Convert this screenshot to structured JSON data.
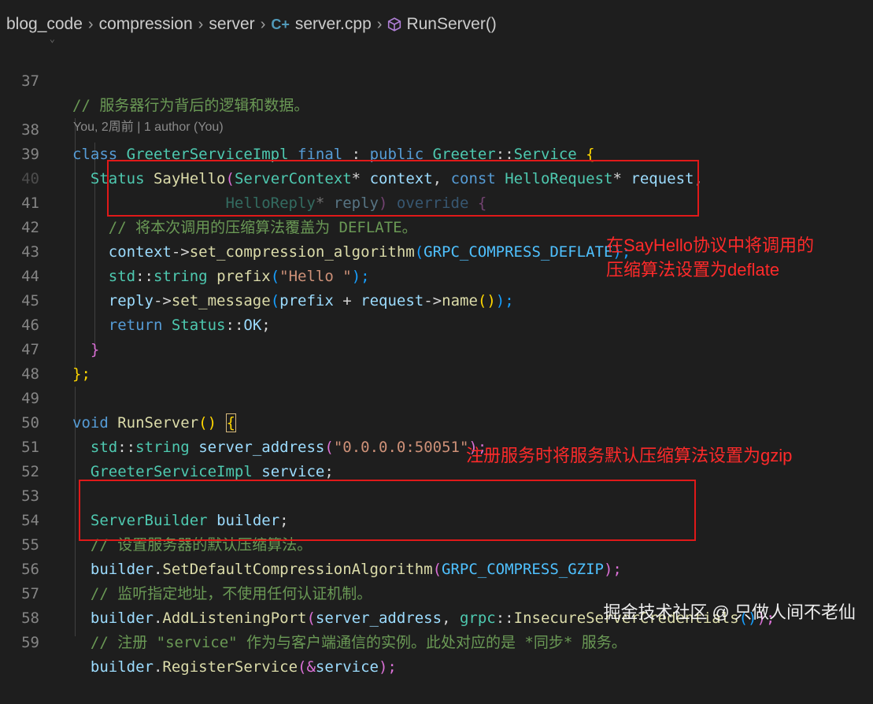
{
  "breadcrumb": {
    "items": [
      "blog_code",
      "compression",
      "server",
      "server.cpp",
      "RunServer()"
    ],
    "separator": ">",
    "file_icon": "cpp-icon",
    "symbol_icon": "method-cube-icon"
  },
  "blame": "You, 2周前 | 1 author (You)",
  "lines": [
    {
      "num": "37"
    },
    {
      "num": "38"
    },
    {
      "num": "39"
    },
    {
      "num": "40"
    },
    {
      "num": "41"
    },
    {
      "num": "42"
    },
    {
      "num": "43"
    },
    {
      "num": "44"
    },
    {
      "num": "45"
    },
    {
      "num": "46"
    },
    {
      "num": "47"
    },
    {
      "num": "48"
    },
    {
      "num": "49"
    },
    {
      "num": "50"
    },
    {
      "num": "51"
    },
    {
      "num": "52"
    },
    {
      "num": "53"
    },
    {
      "num": "54"
    },
    {
      "num": "55"
    },
    {
      "num": "56"
    },
    {
      "num": "57"
    },
    {
      "num": "58"
    },
    {
      "num": "59"
    }
  ],
  "code": {
    "l37_comment": "// 服务器行为背后的逻辑和数据。",
    "l38": [
      "class",
      "GreeterServiceImpl",
      "final",
      ":",
      "public",
      "Greeter",
      "::",
      "Service",
      "{"
    ],
    "l39": [
      "Status",
      "SayHello",
      "(",
      "ServerContext",
      "*",
      "context",
      ",",
      "const",
      "HelloRequest",
      "*",
      "request",
      ","
    ],
    "l40": [
      "HelloReply",
      "*",
      "reply",
      ")",
      "override",
      "{"
    ],
    "l41_comment": "// 将本次调用的压缩算法覆盖为 DEFLATE。",
    "l42": [
      "context",
      "->",
      "set_compression_algorithm",
      "(",
      "GRPC_COMPRESS_DEFLATE",
      ");"
    ],
    "l43": [
      "std",
      "::",
      "string",
      "prefix",
      "(",
      "\"Hello \"",
      ");"
    ],
    "l44": [
      "reply",
      "->",
      "set_message",
      "(",
      "prefix",
      "+",
      "request",
      "->",
      "name",
      "()",
      ");"
    ],
    "l45": [
      "return",
      "Status",
      "::",
      "OK",
      ";"
    ],
    "l46": [
      "}"
    ],
    "l47": [
      "};"
    ],
    "l49": [
      "void",
      "RunServer",
      "()",
      "{"
    ],
    "l50": [
      "std",
      "::",
      "string",
      "server_address",
      "(",
      "\"0.0.0.0:50051\"",
      ");"
    ],
    "l51": [
      "GreeterServiceImpl",
      "service",
      ";"
    ],
    "l53": [
      "ServerBuilder",
      "builder",
      ";"
    ],
    "l54_comment": "// 设置服务器的默认压缩算法。",
    "l55": [
      "builder",
      ".",
      "SetDefaultCompressionAlgorithm",
      "(",
      "GRPC_COMPRESS_GZIP",
      ");"
    ],
    "l56_comment": "// 监听指定地址，不使用任何认证机制。",
    "l57": [
      "builder",
      ".",
      "AddListeningPort",
      "(",
      "server_address",
      ",",
      "grpc",
      "::",
      "InsecureServerCredentials",
      "()",
      ");"
    ],
    "l58_comment": "// 注册 \"service\" 作为与客户端通信的实例。此处对应的是 *同步* 服务。",
    "l59": [
      "builder",
      ".",
      "RegisterService",
      "(&",
      "service",
      ");"
    ]
  },
  "annotations": {
    "deflate_note_line1": "在SayHello协议中将调用的",
    "deflate_note_line2": "压缩算法设置为deflate",
    "gzip_note": "注册服务时将服务默认压缩算法设置为gzip"
  },
  "watermark": "掘金技术社区 @ 只做人间不老仙",
  "colors": {
    "background": "#1e1e1e",
    "keyword": "#569cd6",
    "type": "#4ec9b0",
    "function": "#dcdcaa",
    "variable": "#9cdcfe",
    "string": "#ce9178",
    "comment": "#6a9955",
    "macro": "#4fc1ff",
    "annotation_red": "#e01919"
  }
}
